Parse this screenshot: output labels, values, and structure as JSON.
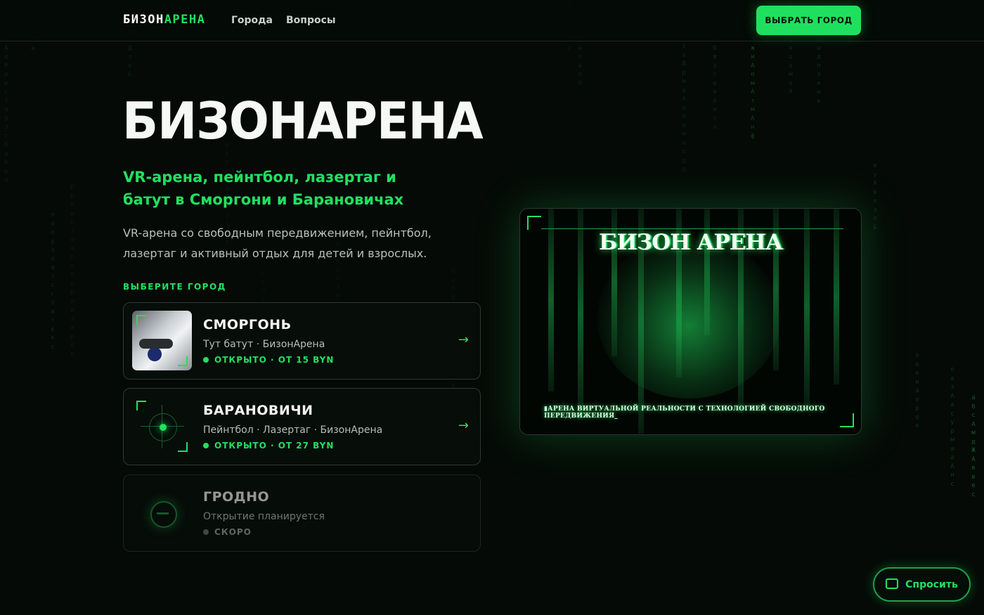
{
  "header": {
    "logo_part1": "БИЗОН",
    "logo_part2": "АРЕНА",
    "nav": [
      "Города",
      "Вопросы"
    ],
    "cta_label": "ВЫБРАТЬ ГОРОД"
  },
  "hero": {
    "title": "БИЗОНАРЕНА",
    "subtitle": "VR-арена, пейнтбол, лазертаг и батут в Сморгони и Барановичах",
    "description": "VR-арена со свободным передвижением, пейнтбол, лазертаг и активный отдых для детей и взрослых.",
    "select_label": "ВЫБЕРИТЕ ГОРОД"
  },
  "cities": [
    {
      "name": "СМОРГОНЬ",
      "sub": "Тут батут · БизонАрена",
      "status": "ОТКРЫТО · ОТ 15 BYN",
      "arrow": "→",
      "icon": "photo-thumbnail"
    },
    {
      "name": "БАРАНОВИЧИ",
      "sub": "Пейнтбол · Лазертаг · БизонАрена",
      "status": "ОТКРЫТО · ОТ 27 BYN",
      "arrow": "→",
      "icon": "target-icon"
    },
    {
      "name": "ГРОДНО",
      "sub": "Открытие планируется",
      "status": "СКОРО",
      "icon": "coming-soon-icon"
    }
  ],
  "media": {
    "title": "БИЗОН АРЕНА",
    "caption": "▮АРЕНА ВИРТУАЛЬНОЙ РЕАЛЬНОСТИ С ТЕХНОЛОГИЕЙ СВОБОДНОГО ПЕРЕДВИЖЕНИЯ_"
  },
  "chat": {
    "label": "Спросить",
    "icon": "chat-bubble-icon"
  },
  "colors": {
    "accent": "#22e060",
    "background": "#050a06",
    "text": "#e8efe9"
  }
}
